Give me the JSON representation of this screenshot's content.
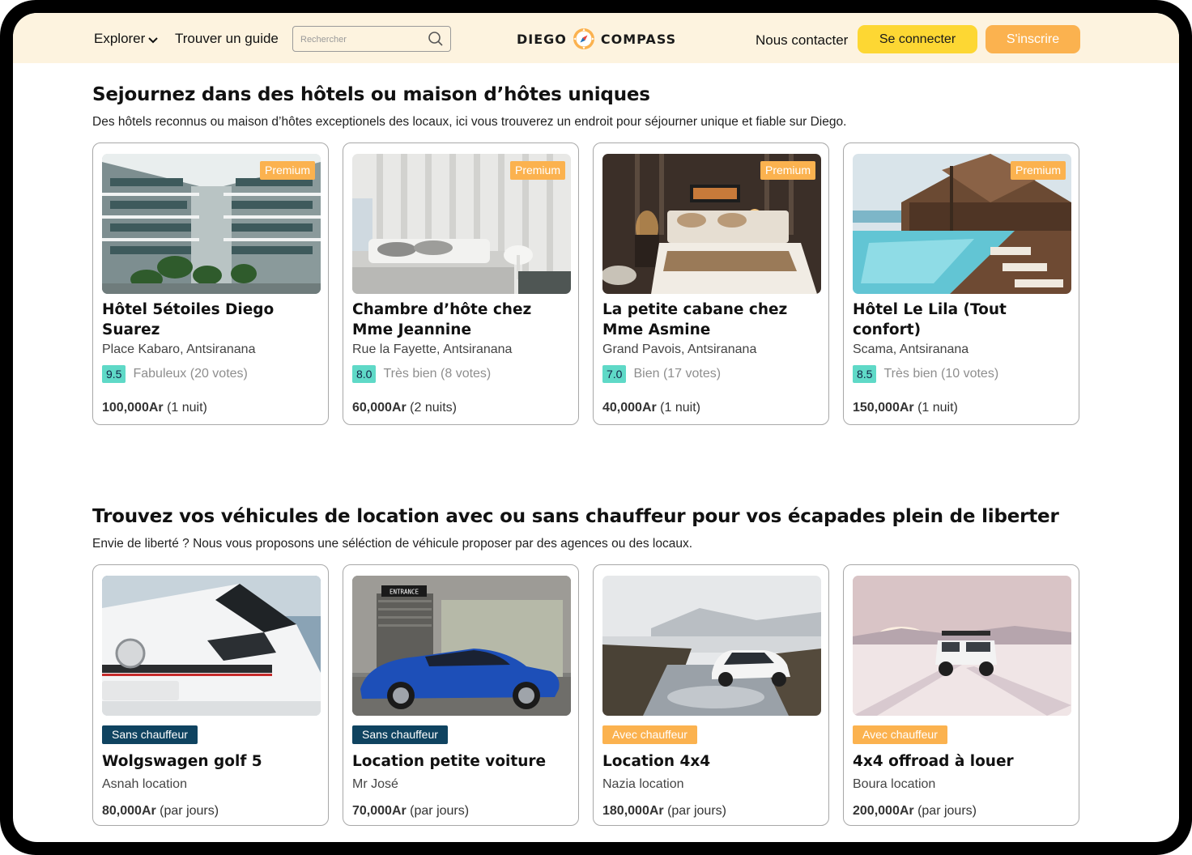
{
  "header": {
    "explore_label": "Explorer",
    "guide_label": "Trouver un guide",
    "search_placeholder": "Rechercher",
    "logo_left": "DIEGO",
    "logo_right": "COMPASS",
    "contact_label": "Nous contacter",
    "login_label": "Se connecter",
    "signup_label": "S'inscrire"
  },
  "colors": {
    "header_bg": "#fdf3df",
    "yellow": "#fdd733",
    "orange": "#fbb24f",
    "teal": "#5fd9c7",
    "navy": "#0f4360"
  },
  "hotels": {
    "title": "Sejournez dans des hôtels ou maison d’hôtes uniques",
    "subtitle": "Des hôtels reconnus ou maison d’hôtes exceptionels des locaux, ici vous trouverez un endroit pour séjourner unique et fiable sur Diego.",
    "items": [
      {
        "badge": "Premium",
        "name": "Hôtel 5étoiles Diego Suarez",
        "address": "Place Kabaro, Antsiranana",
        "score": "9.5",
        "verdict": "Fabuleux (20 votes)",
        "price": "100,000Ar",
        "duration": " (1 nuit)"
      },
      {
        "badge": "Premium",
        "name": "Chambre d’hôte chez Mme Jeannine",
        "address": "Rue la Fayette, Antsiranana",
        "score": "8.0",
        "verdict": "Très bien (8 votes)",
        "price": "60,000Ar",
        "duration": " (2 nuits)"
      },
      {
        "badge": "Premium",
        "name": "La petite cabane chez Mme Asmine",
        "address": "Grand Pavois, Antsiranana",
        "score": "7.0",
        "verdict": "Bien (17 votes)",
        "price": "40,000Ar",
        "duration": " (1 nuit)"
      },
      {
        "badge": "Premium",
        "name": "Hôtel Le Lila (Tout confort)",
        "address": "Scama, Antsiranana",
        "score": "8.5",
        "verdict": "Très bien (10 votes)",
        "price": "150,000Ar",
        "duration": " (1 nuit)"
      }
    ]
  },
  "vehicles": {
    "title": "Trouvez vos véhicules de location avec ou sans chauffeur pour vos écapades plein de liberter",
    "subtitle": "Envie de liberté ? Nous vous proposons une séléction de véhicule proposer par des agences ou des locaux.",
    "items": [
      {
        "tag": "Sans chauffeur",
        "tag_color": "#0f4360",
        "name": "Wolgswagen golf 5",
        "owner": "Asnah location",
        "price": "80,000Ar",
        "duration": " (par jours)"
      },
      {
        "tag": "Sans chauffeur",
        "tag_color": "#0f4360",
        "name": "Location petite voiture",
        "owner": "Mr José",
        "price": "70,000Ar",
        "duration": " (par jours)"
      },
      {
        "tag": "Avec chauffeur",
        "tag_color": "#fbb24f",
        "name": "Location 4x4",
        "owner": "Nazia location",
        "price": "180,000Ar",
        "duration": " (par jours)"
      },
      {
        "tag": "Avec chauffeur",
        "tag_color": "#fbb24f",
        "name": "4x4 offroad à louer",
        "owner": "Boura location",
        "price": "200,000Ar",
        "duration": " (par jours)"
      }
    ],
    "entrance_sign": "ENTRANCE"
  }
}
